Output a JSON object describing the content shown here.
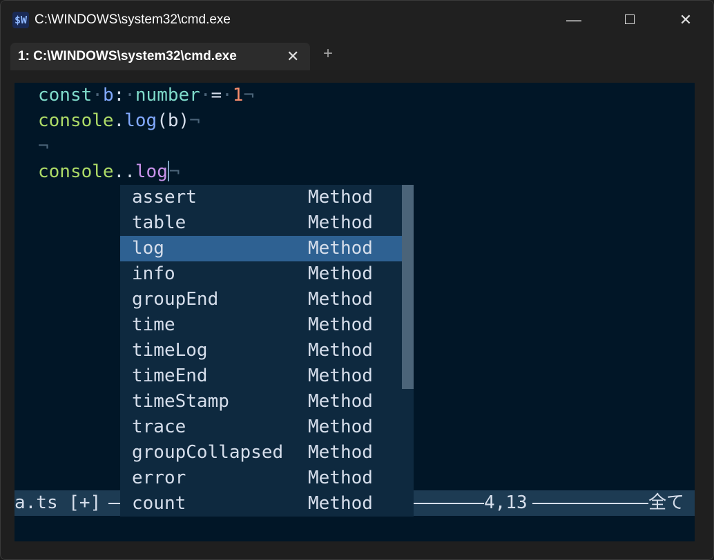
{
  "window": {
    "title": "C:\\WINDOWS\\system32\\cmd.exe",
    "app_icon_text": "$W",
    "controls": {
      "minimize": "—",
      "maximize": "",
      "close": "✕"
    }
  },
  "tabs": [
    {
      "label": "1: C:\\WINDOWS\\system32\\cmd.exe",
      "close": "✕"
    }
  ],
  "new_tab": "+",
  "editor": {
    "line1": {
      "kw": "const",
      "name": "b",
      "colon": ":",
      "type": "number",
      "eq": "=",
      "value": "1",
      "eol": "¬"
    },
    "line2": {
      "obj": "console",
      "dot": ".",
      "method": "log",
      "open": "(",
      "arg": "b",
      "close": ")",
      "eol": "¬"
    },
    "line3": {
      "eol": "¬"
    },
    "line4": {
      "obj": "console",
      "dots": "..",
      "method": "log",
      "eol": "¬"
    }
  },
  "statusline": {
    "file": "a.ts [+]",
    "position": "4,13",
    "scroll": "全て"
  },
  "completion": {
    "items": [
      {
        "name": "assert",
        "kind": "Method"
      },
      {
        "name": "table",
        "kind": "Method"
      },
      {
        "name": "log",
        "kind": "Method"
      },
      {
        "name": "info",
        "kind": "Method"
      },
      {
        "name": "groupEnd",
        "kind": "Method"
      },
      {
        "name": "time",
        "kind": "Method"
      },
      {
        "name": "timeLog",
        "kind": "Method"
      },
      {
        "name": "timeEnd",
        "kind": "Method"
      },
      {
        "name": "timeStamp",
        "kind": "Method"
      },
      {
        "name": "trace",
        "kind": "Method"
      },
      {
        "name": "groupCollapsed",
        "kind": "Method"
      },
      {
        "name": "error",
        "kind": "Method"
      },
      {
        "name": "count",
        "kind": "Method"
      }
    ],
    "selected_index": 2
  },
  "colors": {
    "terminal_bg": "#011627",
    "popup_bg": "#0e293f",
    "popup_selected": "#2e6192",
    "statusline_bg": "#1d3b53"
  }
}
